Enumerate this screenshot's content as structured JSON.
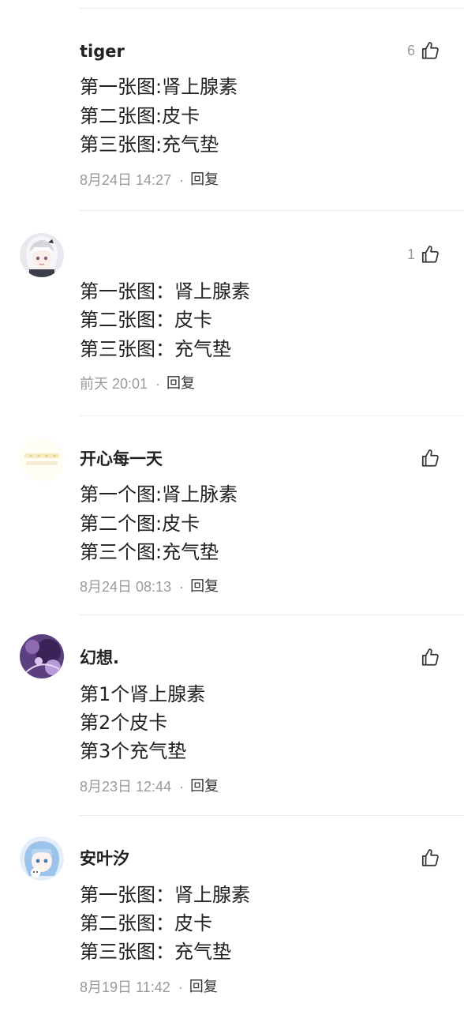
{
  "comments": [
    {
      "username": "tiger",
      "likes": "6",
      "lines": [
        "第一张图:肾上腺素",
        "第二张图:皮卡",
        "第三张图:充气垫"
      ],
      "time": "8月24日 14:27",
      "reply": "回复"
    },
    {
      "username": "",
      "likes": "1",
      "lines": [
        "第一张图：肾上腺素",
        "第二张图：皮卡",
        "第三张图：充气垫"
      ],
      "time": "前天 20:01",
      "reply": "回复"
    },
    {
      "username": "开心每一天",
      "likes": "",
      "lines": [
        "第一个图:肾上脉素",
        "第二个图:皮卡",
        "第三个图:充气垫"
      ],
      "time": "8月24日 08:13",
      "reply": "回复"
    },
    {
      "username": "幻想.",
      "likes": "",
      "lines": [
        "第1个肾上腺素",
        "第2个皮卡",
        "第3个充气垫"
      ],
      "time": "8月23日 12:44",
      "reply": "回复"
    },
    {
      "username": "安叶汐",
      "likes": "",
      "lines": [
        "第一张图：肾上腺素",
        "第二张图：皮卡",
        "第三张图：充气垫"
      ],
      "time": "8月19日 11:42",
      "reply": "回复"
    }
  ],
  "separator": "·",
  "icons": {
    "like": "thumbs-up-icon",
    "avatar": "user-avatar-image"
  }
}
